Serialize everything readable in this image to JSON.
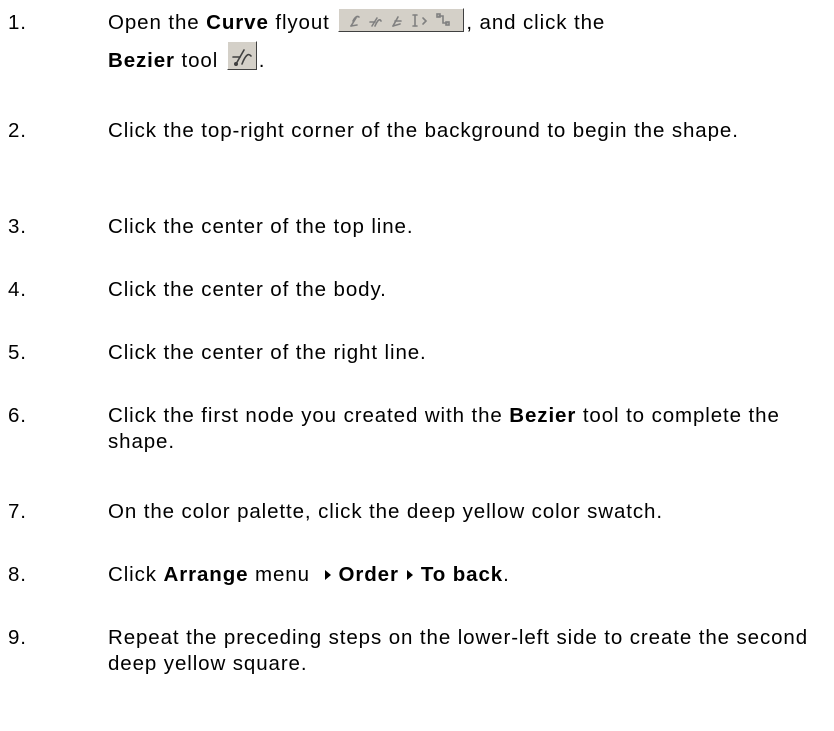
{
  "steps": [
    {
      "num": "1.",
      "parts": {
        "a": "Open the ",
        "b": "Curve",
        "c": " flyout ",
        "d": ", and click the",
        "e": "Bezier",
        "f": " tool ",
        "g": "."
      },
      "icons": [
        "curve-flyout-toolbar",
        "bezier-tool"
      ]
    },
    {
      "num": "2.",
      "text": "Click the top-right corner of the background to begin the shape."
    },
    {
      "num": "3.",
      "text": "Click the center of the top line."
    },
    {
      "num": "4.",
      "text": "Click the center of the body."
    },
    {
      "num": "5.",
      "text": "Click the center of the right line."
    },
    {
      "num": "6.",
      "parts": {
        "a": "Click the first node you created with the ",
        "b": "Bezier",
        "c": " tool to complete the shape."
      }
    },
    {
      "num": "7.",
      "text": "On the color palette, click the deep yellow color swatch."
    },
    {
      "num": "8.",
      "parts": {
        "a": "Click ",
        "b": "Arrange",
        "c": " menu ",
        "d": "Order",
        "e": "To back",
        "f": "."
      }
    },
    {
      "num": "9.",
      "text": "Repeat the preceding steps on the lower-left side to create the second deep yellow square."
    }
  ]
}
